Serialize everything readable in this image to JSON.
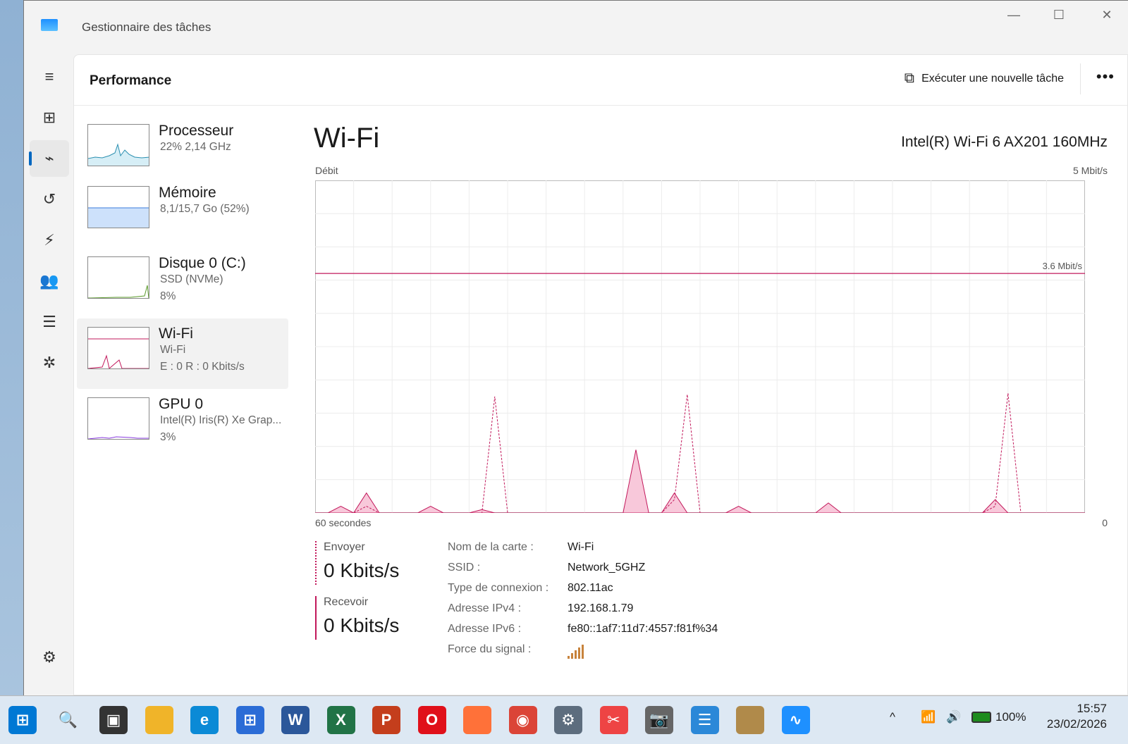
{
  "window": {
    "title": "Gestionnaire des tâches",
    "minimize": "—",
    "maximize": "☐",
    "close": "✕"
  },
  "header": {
    "title": "Performance",
    "run_task": "Exécuter une nouvelle tâche",
    "more": "•••"
  },
  "rail": [
    "hamburger-icon",
    "processes-icon",
    "performance-icon",
    "history-icon",
    "startup-icon",
    "users-icon",
    "details-icon",
    "services-icon",
    "settings-icon"
  ],
  "devices": [
    {
      "name": "Processeur",
      "sub1": "22%  2,14 GHz",
      "sub2": ""
    },
    {
      "name": "Mémoire",
      "sub1": "8,1/15,7 Go (52%)",
      "sub2": ""
    },
    {
      "name": "Disque 0 (C:)",
      "sub1": "SSD (NVMe)",
      "sub2": "8%"
    },
    {
      "name": "Wi-Fi",
      "sub1": "Wi-Fi",
      "sub2": "E : 0  R : 0 Kbits/s"
    },
    {
      "name": "GPU 0",
      "sub1": "Intel(R) Iris(R) Xe Grap...",
      "sub2": "3%"
    }
  ],
  "main": {
    "title": "Wi-Fi",
    "adapter": "Intel(R) Wi-Fi 6 AX201 160MHz"
  },
  "chart_data": {
    "type": "area",
    "ylabel": "Débit",
    "ymax_label": "5 Mbit/s",
    "ylim": [
      0,
      5
    ],
    "unit": "Mbit/s",
    "xlabel_left": "60 secondes",
    "xlabel_right": "0",
    "xlim": [
      60,
      0
    ],
    "reference_line": {
      "value": 3.6,
      "label": "3.6 Mbit/s"
    },
    "color": "#c2185b",
    "series": [
      {
        "name": "Envoyer",
        "style": "solid-fill",
        "points": {
          "2": 0.1,
          "4": 0.3,
          "9": 0.1,
          "13": 0.05,
          "25": 0.95,
          "28": 0.3,
          "33": 0.1,
          "40": 0.15,
          "53": 0.2
        }
      },
      {
        "name": "Recevoir",
        "style": "dashed",
        "points": {
          "4": 0.1,
          "14": 1.75,
          "28": 0.2,
          "29": 1.78,
          "53": 0.1,
          "54": 1.8
        }
      }
    ]
  },
  "stats": {
    "send_label": "Envoyer",
    "send_value": "0 Kbits/s",
    "recv_label": "Recevoir",
    "recv_value": "0 Kbits/s"
  },
  "details": [
    {
      "k": "Nom de la carte :",
      "v": "Wi-Fi"
    },
    {
      "k": "SSID :",
      "v": "Network_5GHZ"
    },
    {
      "k": "Type de connexion :",
      "v": "802.11ac"
    },
    {
      "k": "Adresse IPv4 :",
      "v": "192.168.1.79"
    },
    {
      "k": "Adresse IPv6 :",
      "v": "fe80::1af7:11d7:4557:f81f%34"
    },
    {
      "k": "Force du signal :",
      "v": ""
    }
  ],
  "signal_strength": {
    "bars": 5,
    "of": 5
  },
  "taskbar": {
    "apps": [
      "start",
      "search",
      "task-view",
      "file-explorer",
      "edge",
      "store",
      "word",
      "excel",
      "powerpoint",
      "opera",
      "firefox",
      "chrome",
      "settings",
      "snipping-tool",
      "camera",
      "notepad",
      "misc-app",
      "task-manager"
    ],
    "battery": "100%",
    "time": "15:57",
    "date": "23/02/2026"
  }
}
